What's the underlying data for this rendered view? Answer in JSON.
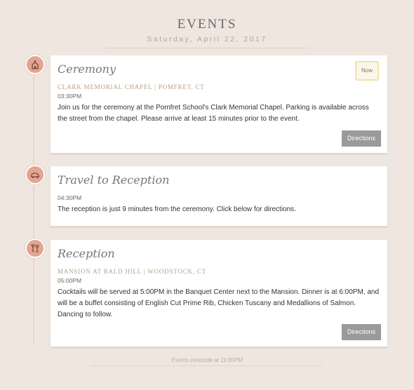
{
  "header": {
    "title": "EVENTS",
    "date": "Saturday, April 22, 2017"
  },
  "events": [
    {
      "icon": "church-icon",
      "title": "Ceremony",
      "badge": "Now",
      "location": "Clark Memorial Chapel | Pomfret, CT",
      "time": "03:30PM",
      "description": "Join us for the ceremony at the Pomfret School's Clark Memorial Chapel. Parking is available across the street from the chapel. Please arrive at least 15 minutes prior to the event.",
      "button": "Directions"
    },
    {
      "icon": "car-icon",
      "title": "Travel to Reception",
      "time": "04:30PM",
      "description": "The reception is just 9 minutes from the ceremony. Click below for directions."
    },
    {
      "icon": "cocktail-icon",
      "title": "Reception",
      "location": "Mansion at Bald Hill | Woodstock, CT",
      "time": "05:00PM",
      "description": "Cocktails will be served at 5:00PM in the Banquet Center next to the Mansion. Dinner is at 6:00PM, and will be a buffet consisting of English Cut Prime Rib, Chicken Tuscany and Medallions of Salmon. Dancing to follow.",
      "button": "Directions"
    }
  ],
  "footer": {
    "note": "Events conclude at 11:00PM"
  }
}
